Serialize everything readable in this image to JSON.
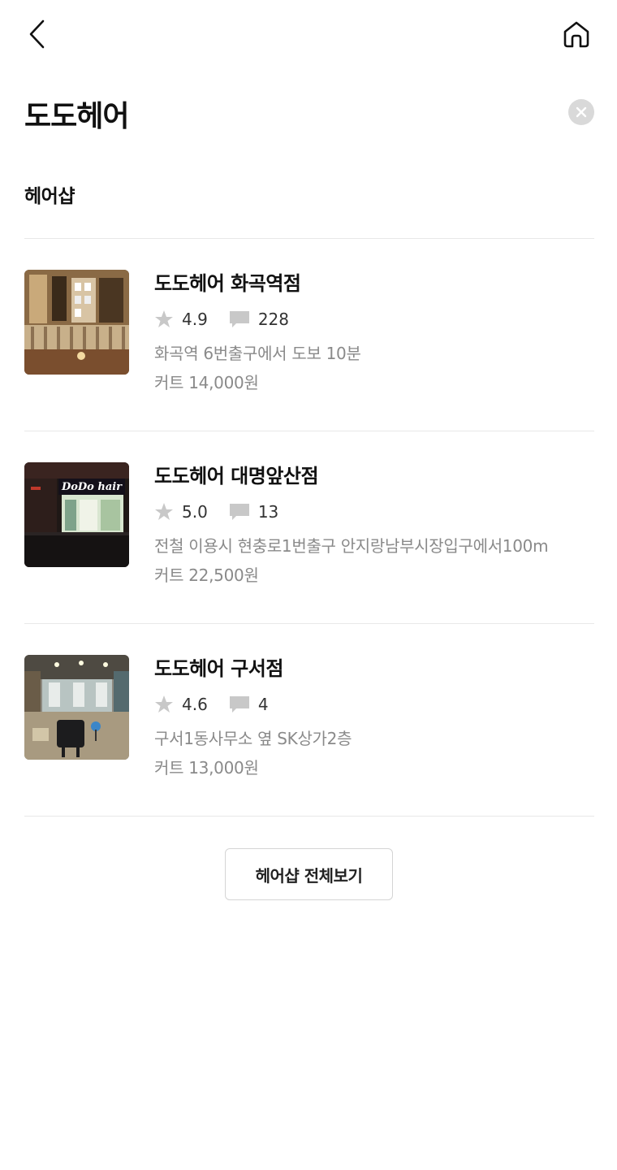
{
  "header": {
    "back_icon": "back-arrow-icon",
    "home_icon": "home-icon"
  },
  "search": {
    "query": "도도헤어",
    "clear_icon": "clear-x-icon"
  },
  "section": {
    "title": "헤어샵"
  },
  "shops": [
    {
      "name": "도도헤어 화곡역점",
      "rating": "4.9",
      "reviews": "228",
      "location": "화곡역 6번출구에서 도보 10분",
      "price": "커트 14,000원"
    },
    {
      "name": "도도헤어 대명앞산점",
      "rating": "5.0",
      "reviews": "13",
      "location": "전철 이용시 현충로1번출구 안지랑남부시장입구에서100m",
      "price": "커트 22,500원"
    },
    {
      "name": "도도헤어 구서점",
      "rating": "4.6",
      "reviews": "4",
      "location": "구서1동사무소 옆 SK상가2층",
      "price": "커트 13,000원"
    }
  ],
  "thumb_sign_text": "DoDo hair",
  "view_all_label": "헤어샵 전체보기",
  "colors": {
    "text_primary": "#111111",
    "text_secondary": "#8a8a8a",
    "icon_gray": "#c8c8c8",
    "divider": "#e8e8e8"
  }
}
